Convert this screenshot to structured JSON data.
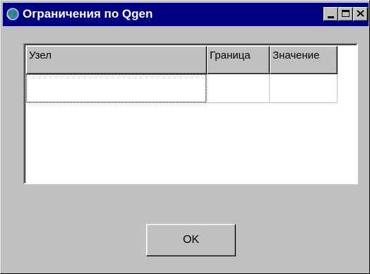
{
  "window": {
    "title": "Ограничения по Qgen"
  },
  "titlebar_buttons": {
    "minimize_icon": "minimize-icon",
    "maximize_icon": "maximize-icon",
    "close_icon": "close-icon"
  },
  "grid": {
    "columns": [
      "Узел",
      "Граница",
      "Значение"
    ],
    "rows": [
      [
        "",
        "",
        ""
      ]
    ]
  },
  "footer": {
    "ok_label": "OK"
  },
  "colors": {
    "titlebar": "#000080",
    "face": "#c0c0c0"
  }
}
